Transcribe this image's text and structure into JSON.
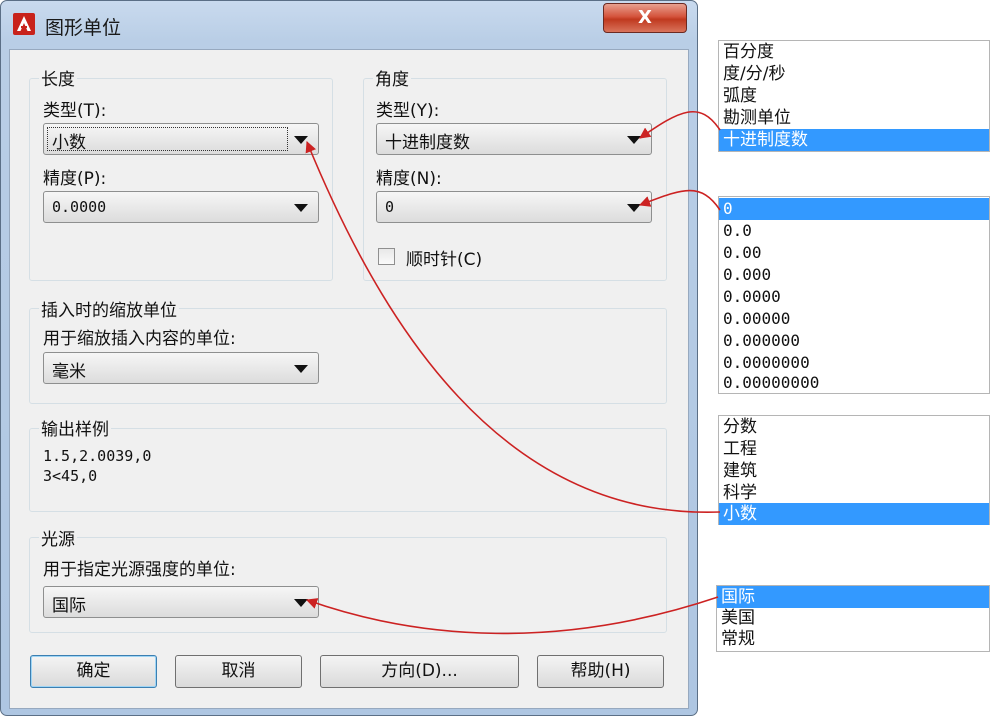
{
  "dialog": {
    "title": "图形单位",
    "close_label": "X"
  },
  "length": {
    "group_label": "长度",
    "type_label": "类型(T):",
    "type_value": "小数",
    "precision_label": "精度(P):",
    "precision_value": "0.0000"
  },
  "angle": {
    "group_label": "角度",
    "type_label": "类型(Y):",
    "type_value": "十进制度数",
    "precision_label": "精度(N):",
    "precision_value": "0",
    "clockwise_label": "顺时针(C)",
    "clockwise_checked": false
  },
  "insertion": {
    "group_label": "插入时的缩放单位",
    "desc": "用于缩放插入内容的单位:",
    "value": "毫米"
  },
  "sample": {
    "group_label": "输出样例",
    "line1": "1.5,2.0039,0",
    "line2": "3<45,0"
  },
  "lighting": {
    "group_label": "光源",
    "desc": "用于指定光源强度的单位:",
    "value": "国际"
  },
  "buttons": {
    "ok": "确定",
    "cancel": "取消",
    "direction": "方向(D)...",
    "help": "帮助(H)"
  },
  "angle_type_options": [
    "百分度",
    "度/分/秒",
    "弧度",
    "勘测单位",
    "十进制度数"
  ],
  "angle_precision_options": [
    "0",
    "0.0",
    "0.00",
    "0.000",
    "0.0000",
    "0.00000",
    "0.000000",
    "0.0000000",
    "0.00000000"
  ],
  "length_type_options": [
    "分数",
    "工程",
    "建筑",
    "科学",
    "小数"
  ],
  "lighting_options": [
    "国际",
    "美国",
    "常规"
  ],
  "colors": {
    "selection": "#3399ff",
    "arrow": "#cc2222"
  }
}
